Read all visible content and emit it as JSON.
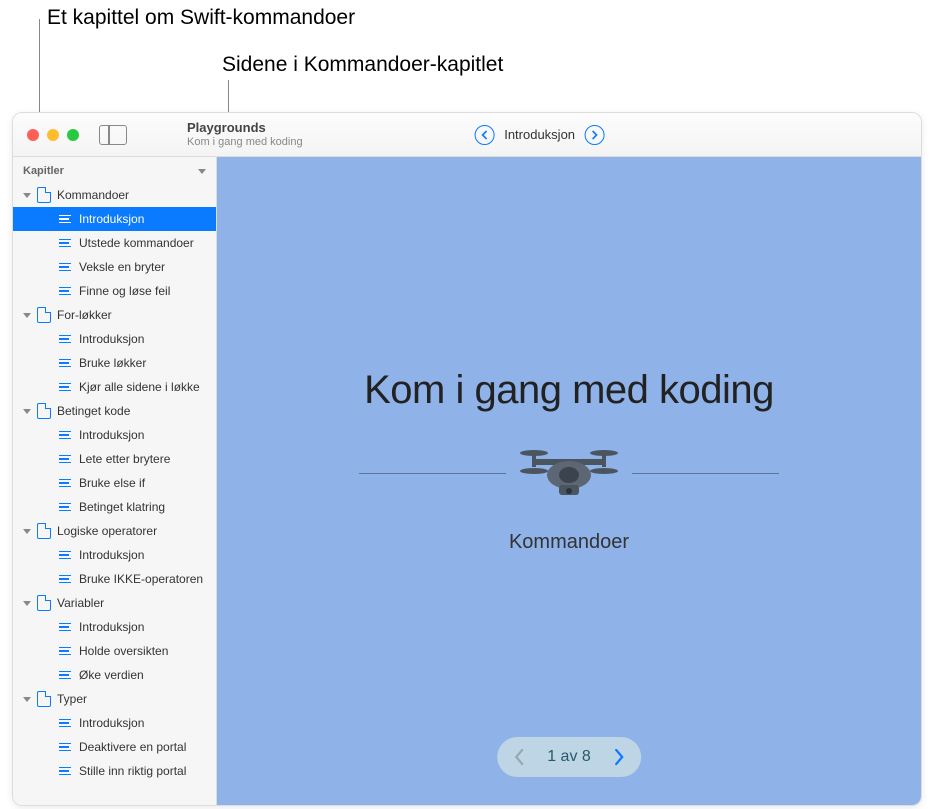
{
  "callouts": {
    "top1": "Et kapittel om Swift-kommandoer",
    "top2": "Sidene i Kommandoer-kapitlet"
  },
  "toolbar": {
    "app_title": "Playgrounds",
    "app_subtitle": "Kom i gang med koding",
    "nav_title": "Introduksjon"
  },
  "sidebar": {
    "header": "Kapitler",
    "chapters": [
      {
        "title": "Kommandoer",
        "pages": [
          "Introduksjon",
          "Utstede kommandoer",
          "Veksle en bryter",
          "Finne og løse feil"
        ]
      },
      {
        "title": "For-løkker",
        "pages": [
          "Introduksjon",
          "Bruke løkker",
          "Kjør alle sidene i løkke"
        ]
      },
      {
        "title": "Betinget kode",
        "pages": [
          "Introduksjon",
          "Lete etter brytere",
          "Bruke else if",
          "Betinget klatring"
        ]
      },
      {
        "title": "Logiske operatorer",
        "pages": [
          "Introduksjon",
          "Bruke IKKE-operatoren"
        ]
      },
      {
        "title": "Variabler",
        "pages": [
          "Introduksjon",
          "Holde oversikten",
          "Øke verdien"
        ]
      },
      {
        "title": "Typer",
        "pages": [
          "Introduksjon",
          "Deaktivere en portal",
          "Stille inn riktig portal"
        ]
      }
    ],
    "selected": {
      "chapter": 0,
      "page": 0
    }
  },
  "content": {
    "title": "Kom i gang med koding",
    "subtitle": "Kommandoer"
  },
  "pager": {
    "text": "1 av 8"
  }
}
